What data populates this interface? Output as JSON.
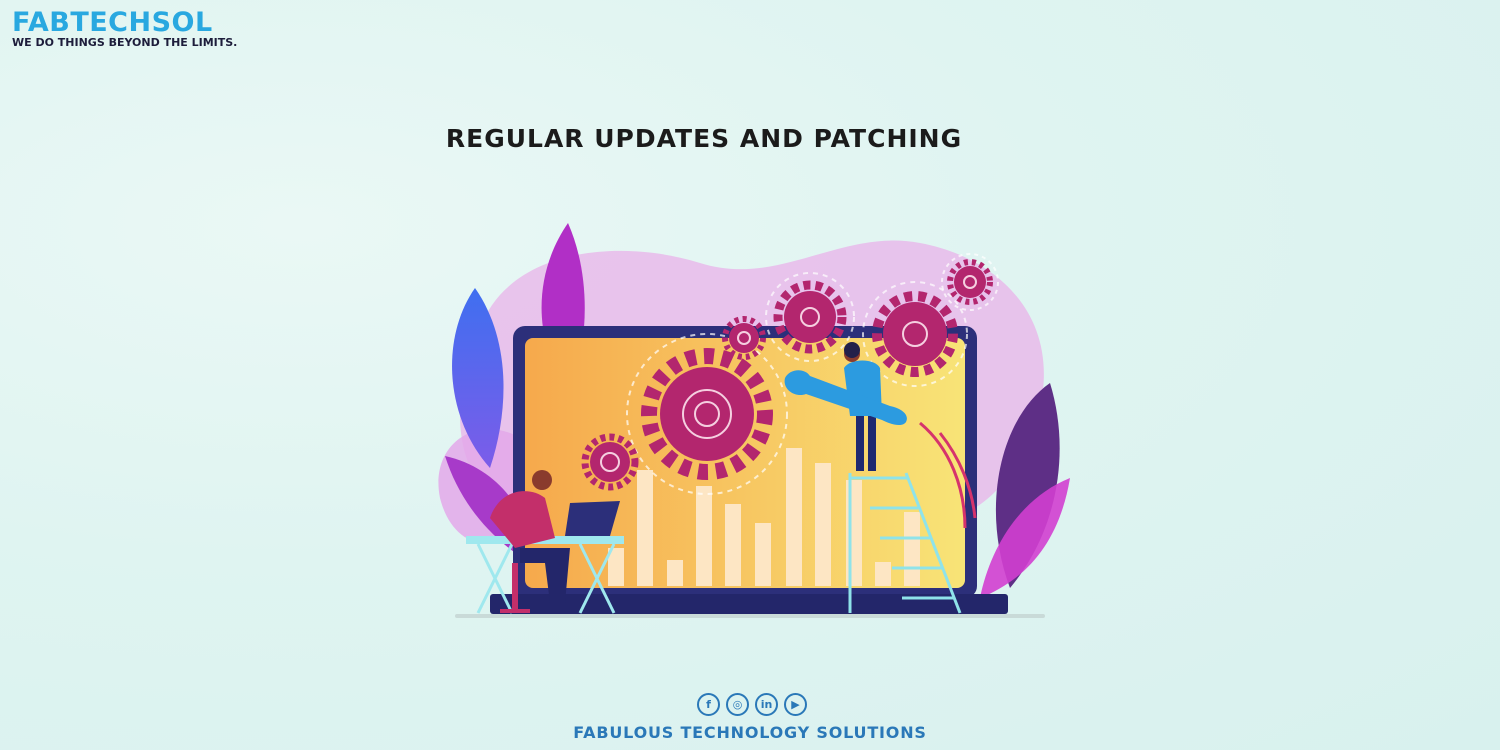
{
  "brand": {
    "name": "FABTECHSOL",
    "tagline": "WE DO THINGS BEYOND THE LIMITS.",
    "color": "#29a8e0"
  },
  "main": {
    "title": "REGULAR UPDATES AND PATCHING"
  },
  "illustration": {
    "subject": "laptop with gears, bar chart, worker with wrench on ladder, person at desk with laptop"
  },
  "footer": {
    "socials": [
      {
        "icon": "facebook-icon",
        "glyph": "f"
      },
      {
        "icon": "instagram-icon",
        "glyph": "◎"
      },
      {
        "icon": "linkedin-icon",
        "glyph": "in"
      },
      {
        "icon": "youtube-icon",
        "glyph": "▶"
      }
    ],
    "company": "FABULOUS TECHNOLOGY SOLUTIONS",
    "color": "#2a78b8"
  }
}
